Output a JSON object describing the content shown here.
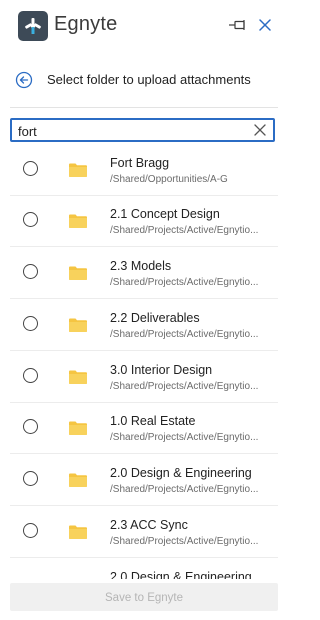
{
  "app": {
    "title": "Egnyte",
    "logo_icon": "egnyte-logo-icon",
    "pin_icon": "pin-icon",
    "close_icon": "close-icon",
    "accent_color": "#2b6cc4"
  },
  "subheader": {
    "text": "Select folder to upload attachments",
    "back_icon": "back-arrow-icon"
  },
  "search": {
    "value": "fort",
    "clear_icon": "clear-icon"
  },
  "folders": [
    {
      "name": "Fort Bragg",
      "path": "/Shared/Opportunities/A-G"
    },
    {
      "name": "2.1 Concept Design",
      "path": "/Shared/Projects/Active/Egnytio..."
    },
    {
      "name": "2.3 Models",
      "path": "/Shared/Projects/Active/Egnytio..."
    },
    {
      "name": "2.2 Deliverables",
      "path": "/Shared/Projects/Active/Egnytio..."
    },
    {
      "name": "3.0 Interior Design",
      "path": "/Shared/Projects/Active/Egnytio..."
    },
    {
      "name": "1.0 Real Estate",
      "path": "/Shared/Projects/Active/Egnytio..."
    },
    {
      "name": "2.0 Design & Engineering",
      "path": "/Shared/Projects/Active/Egnytio..."
    },
    {
      "name": "2.3 ACC Sync",
      "path": "/Shared/Projects/Active/Egnytio..."
    }
  ],
  "partial_folder": {
    "name": "2.0 Design & Engineering"
  },
  "folder_color": "#f5c542",
  "footer": {
    "save_label": "Save to Egnyte"
  }
}
